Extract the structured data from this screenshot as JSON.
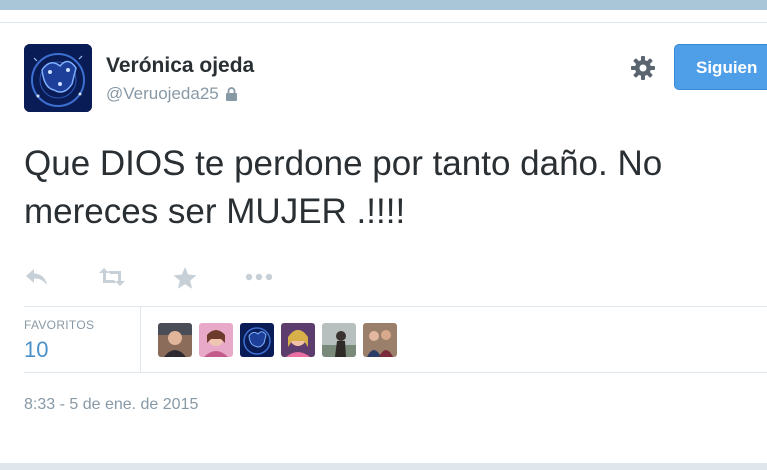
{
  "tweet": {
    "author": {
      "full_name": "Verónica ojeda",
      "handle": "@Veruojeda25",
      "protected_icon": "lock-icon",
      "avatar_icon": "zodiac-constellation-avatar"
    },
    "follow_button_label": "Siguien",
    "settings_icon": "gear-icon",
    "text_lines": [
      "Que DIOS te perdone por tanto daño. No",
      "mereces ser MUJER .!!!!"
    ],
    "actions": [
      {
        "name": "reply",
        "icon": "reply-icon"
      },
      {
        "name": "retweet",
        "icon": "retweet-icon"
      },
      {
        "name": "favorite",
        "icon": "star-icon"
      },
      {
        "name": "more",
        "icon": "more-dots-icon"
      }
    ],
    "stats": {
      "label": "FAVORITOS",
      "count": "10"
    },
    "favorited_by_count_shown": 6,
    "timestamp": "8:33 - 5 de ene. de 2015"
  },
  "colors": {
    "accent_blue": "#4f9ee8",
    "name_text": "#292f33",
    "muted_text": "#8899a6",
    "link_count": "#4a90c9",
    "top_bar": "#a9c6d8"
  }
}
